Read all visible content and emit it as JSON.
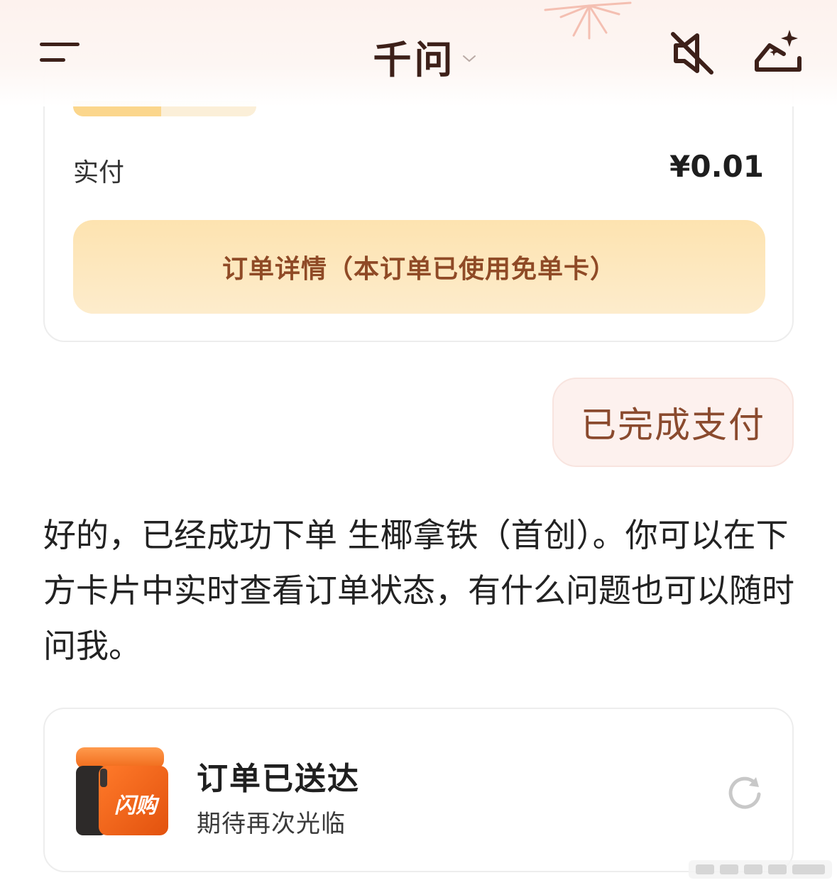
{
  "header": {
    "title": "千问",
    "menu_icon": "menu-icon",
    "mute_icon": "speaker-mute-icon",
    "new_chat_icon": "new-chat-sparkle-icon"
  },
  "payment_card": {
    "progress_fraction": 0.48,
    "paid_label": "实付",
    "paid_amount": "¥0.01",
    "detail_button": "订单详情（本订单已使用免单卡）"
  },
  "user_message": "已完成支付",
  "assistant_reply": "好的，已经成功下单 生椰拿铁（首创）。你可以在下方卡片中实时查看订单状态，有什么问题也可以随时问我。",
  "status_card": {
    "icon": "shangou-box-icon",
    "icon_text": "闪购",
    "title": "订单已送达",
    "subtitle": "期待再次光临",
    "refresh_icon": "refresh-icon"
  },
  "colors": {
    "accent_brown": "#8f4a26",
    "title_dark": "#3d2019",
    "button_bg": "#fde3b0",
    "bubble_bg": "#fdf1ee",
    "brand_orange": "#f46a1c"
  }
}
